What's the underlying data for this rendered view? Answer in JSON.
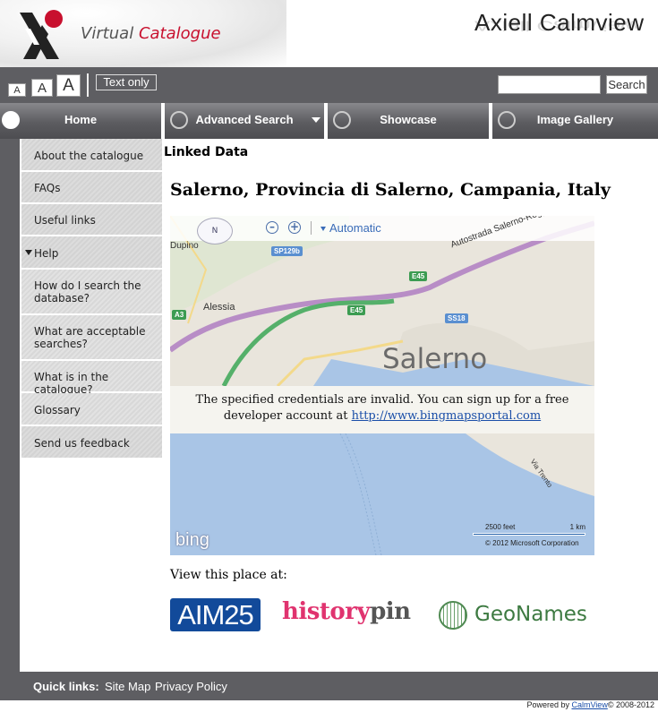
{
  "header": {
    "logo_text_part1": "Virtual ",
    "logo_text_part2": "Catalogue",
    "brand": "Axiell Calmview"
  },
  "utility": {
    "font_small": "A",
    "font_medium": "A",
    "font_large": "A",
    "text_only": "Text only",
    "search_value": "",
    "search_button": "Search"
  },
  "nav": {
    "home": "Home",
    "advanced_search": "Advanced Search",
    "showcase": "Showcase",
    "image_gallery": "Image Gallery"
  },
  "sidebar": {
    "items": [
      {
        "label": "About the catalogue"
      },
      {
        "label": "FAQs"
      },
      {
        "label": "Useful links"
      },
      {
        "label": "Help"
      },
      {
        "label": "How do I search the database?"
      },
      {
        "label": "What are acceptable searches?"
      },
      {
        "label": "What is in the catalogue?"
      },
      {
        "label": "Glossary"
      },
      {
        "label": "Send us feedback"
      }
    ]
  },
  "main": {
    "section_title": "Linked Data",
    "place_title": "Salerno, Provincia di Salerno, Campania, Italy",
    "view_label": "View this place at:"
  },
  "map": {
    "compass": "N",
    "mode": "Automatic",
    "city": "Salerno",
    "label_alessia": "Alessia",
    "label_dupino": "Dupino",
    "label_autostrada": "Autostrada Salerno-Reggio Calabria",
    "label_viatrento": "Via Trento",
    "shields": [
      "SP129b",
      "E45",
      "E45",
      "A3",
      "SS18"
    ],
    "error_text": "The specified credentials are invalid. You can sign up for a free developer account at ",
    "error_link": "http://www.bingmapsportal.com",
    "bing": "bing",
    "scale_feet": "2500 feet",
    "scale_km": "1 km",
    "copyright": "© 2012 Microsoft Corporation"
  },
  "links": {
    "aim25": "AIM25",
    "historypin_a": "history",
    "historypin_b": "pin",
    "geonames": "GeoNames"
  },
  "footer": {
    "quick_links_label": "Quick links:",
    "site_map": "Site Map",
    "privacy_policy": "Privacy Policy",
    "powered_prefix": "Powered by ",
    "powered_link": "CalmView",
    "powered_suffix": "© 2008-2012"
  },
  "colors": {
    "bar_gray": "#5e5e62",
    "accent_red": "#c8102e",
    "link_blue": "#1a4ea8"
  }
}
